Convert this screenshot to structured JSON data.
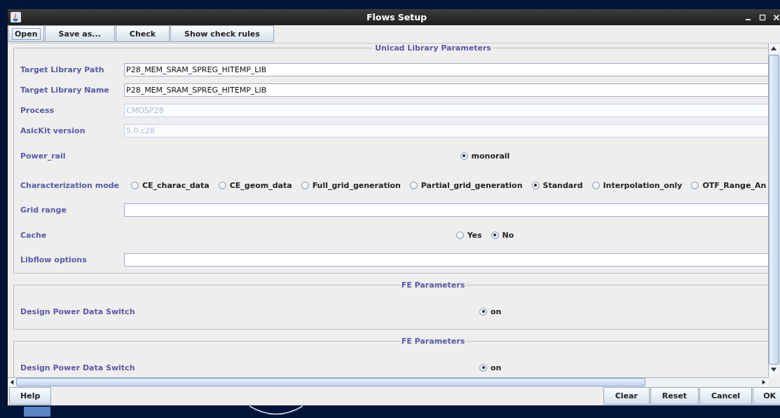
{
  "window": {
    "title": "Flows Setup"
  },
  "toolbar": [
    {
      "label": "Open",
      "focused": true
    },
    {
      "label": "Save as...",
      "focused": false
    },
    {
      "label": "Check",
      "focused": false
    },
    {
      "label": "Show check rules",
      "focused": false
    }
  ],
  "sections": [
    {
      "title": "Unicad Library Parameters",
      "rows": [
        {
          "kind": "field",
          "label": "Target Library Path",
          "value": "P28_MEM_SRAM_SPREG_HITEMP_LIB",
          "disabled": false
        },
        {
          "kind": "field",
          "label": "Target Library Name",
          "value": "P28_MEM_SRAM_SPREG_HITEMP_LIB",
          "disabled": false
        },
        {
          "kind": "field",
          "label": "Process",
          "value": "CMOSP28",
          "disabled": true
        },
        {
          "kind": "field",
          "label": "AsicKit version",
          "value": "5.0.c28",
          "disabled": true
        },
        {
          "kind": "radios",
          "label": "Power_rail",
          "options": [
            {
              "label": "monorail",
              "selected": true
            }
          ]
        },
        {
          "kind": "radios",
          "label": "Characterization mode",
          "options": [
            {
              "label": "CE_charac_data",
              "selected": false
            },
            {
              "label": "CE_geom_data",
              "selected": false
            },
            {
              "label": "Full_grid_generation",
              "selected": false
            },
            {
              "label": "Partial_grid_generation",
              "selected": false
            },
            {
              "label": "Standard",
              "selected": true
            },
            {
              "label": "Interpolation_only",
              "selected": false
            },
            {
              "label": "OTF_Range_An",
              "selected": false
            }
          ]
        },
        {
          "kind": "field",
          "label": "Grid range",
          "disabled": false
        },
        {
          "kind": "radios",
          "label": "Cache",
          "options": [
            {
              "label": "Yes",
              "selected": false
            },
            {
              "label": "No",
              "selected": true
            }
          ]
        },
        {
          "kind": "field",
          "label": "Libflow options",
          "disabled": false
        }
      ]
    },
    {
      "title": "FE Parameters",
      "rows": [
        {
          "kind": "radios",
          "label": "Design Power Data Switch",
          "options": [
            {
              "label": "on",
              "selected": true
            }
          ]
        }
      ]
    },
    {
      "title": "FE Parameters",
      "rows": [
        {
          "kind": "radios",
          "label": "Design Power Data Switch",
          "options": [
            {
              "label": "on",
              "selected": true
            }
          ]
        }
      ]
    }
  ],
  "footer": {
    "left": [
      "Help"
    ],
    "right": [
      "Clear",
      "Reset",
      "Cancel",
      "OK"
    ]
  }
}
